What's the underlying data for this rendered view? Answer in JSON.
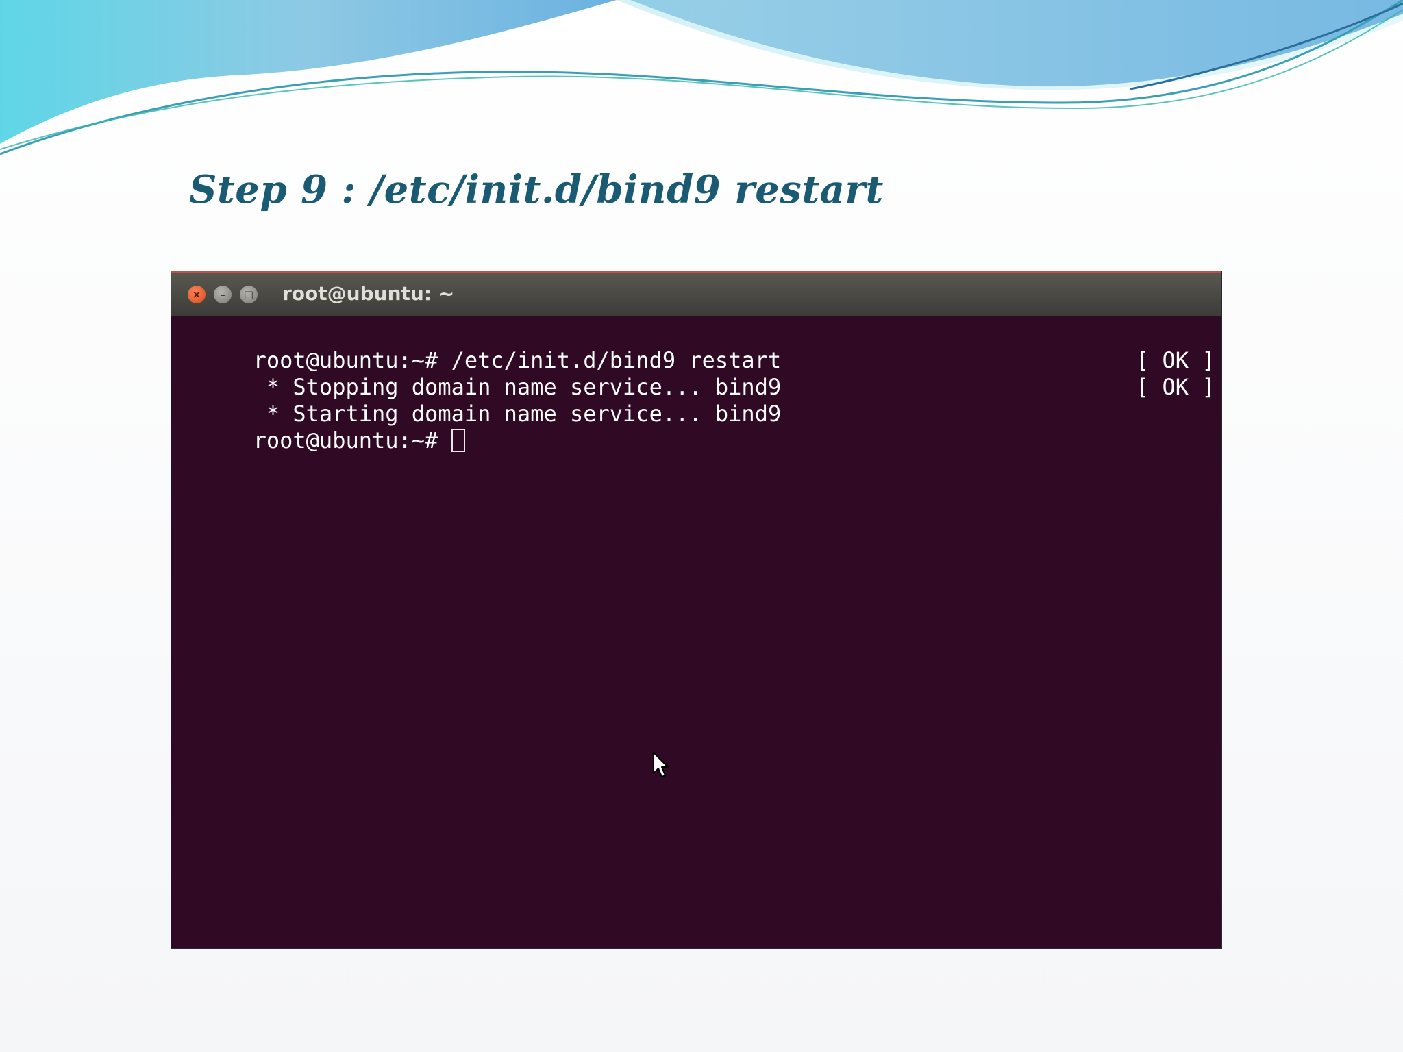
{
  "slide": {
    "title": "Step 9 : /etc/init.d/bind9 restart"
  },
  "terminal": {
    "window_title": "root@ubuntu: ~",
    "lines": [
      {
        "text": "root@ubuntu:~# /etc/init.d/bind9 restart",
        "status": ""
      },
      {
        "text": " * Stopping domain name service... bind9",
        "status": "[ OK ]"
      },
      {
        "text": " * Starting domain name service... bind9",
        "status": "[ OK ]"
      },
      {
        "text": "root@ubuntu:~# ",
        "status": ""
      }
    ]
  },
  "colors": {
    "terminal_bg": "#300a24",
    "title_accent": "#1a5b73",
    "close_button": "#e95420"
  },
  "icons": [
    "close-icon",
    "minimize-icon",
    "maximize-icon",
    "mouse-pointer-icon"
  ]
}
